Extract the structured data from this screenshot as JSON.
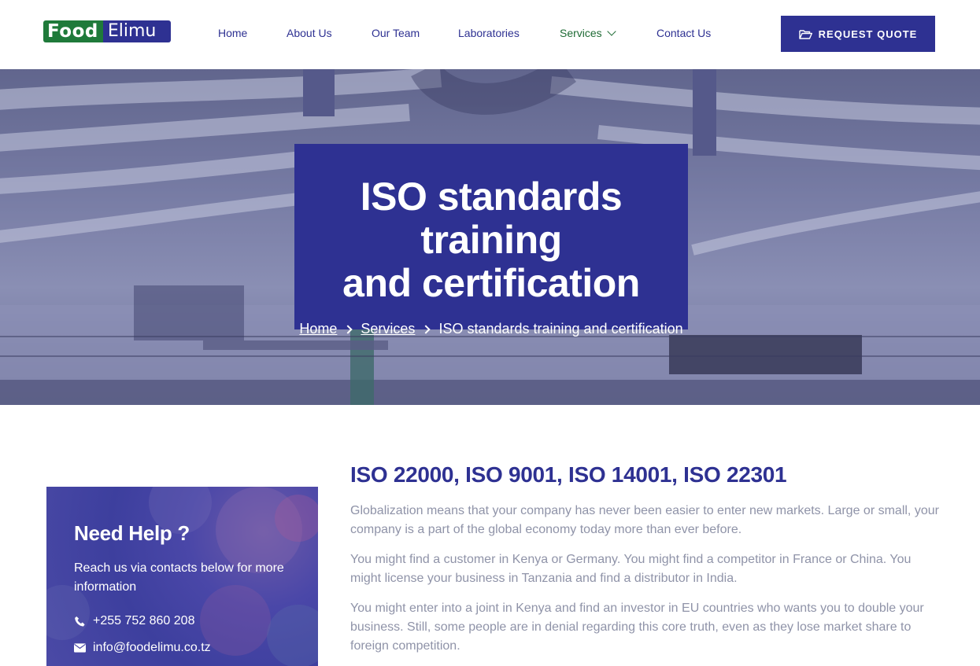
{
  "header": {
    "logo": {
      "part1": "Food",
      "part2": "Elimu"
    },
    "nav": [
      {
        "label": "Home"
      },
      {
        "label": "About Us"
      },
      {
        "label": "Our Team"
      },
      {
        "label": "Laboratories"
      },
      {
        "label": "Services",
        "active": true,
        "has_dropdown": true
      },
      {
        "label": "Contact Us"
      }
    ],
    "cta_label": "REQUEST QUOTE",
    "cta_icon": "folder-open-icon"
  },
  "hero": {
    "title_line1": "ISO standards training",
    "title_line2": "and certification",
    "breadcrumb": {
      "home": "Home",
      "services": "Services",
      "current": "ISO standards training and certification"
    }
  },
  "help": {
    "title": "Need Help ?",
    "text": "Reach us via contacts below for more information",
    "phone": "+255 752 860 208",
    "email": "info@foodelimu.co.tz"
  },
  "content": {
    "heading": "ISO 22000, ISO 9001, ISO 14001, ISO 22301",
    "paragraphs": [
      "Globalization means that your company has never been easier to enter new markets. Large or small, your company is a part of the global economy today more than ever before.",
      "You might find a customer in Kenya or Germany. You might find a competitor in France or China. You might license your business in Tanzania and find a distributor in India.",
      "You might enter into a joint in Kenya and find an investor in EU countries who wants you to double your business. Still, some people are in denial regarding this core truth, even as they lose market share to foreign competition."
    ]
  },
  "colors": {
    "brand_blue": "#2e3192",
    "brand_green": "#1f7a3a",
    "body_text": "#8f93a8"
  }
}
